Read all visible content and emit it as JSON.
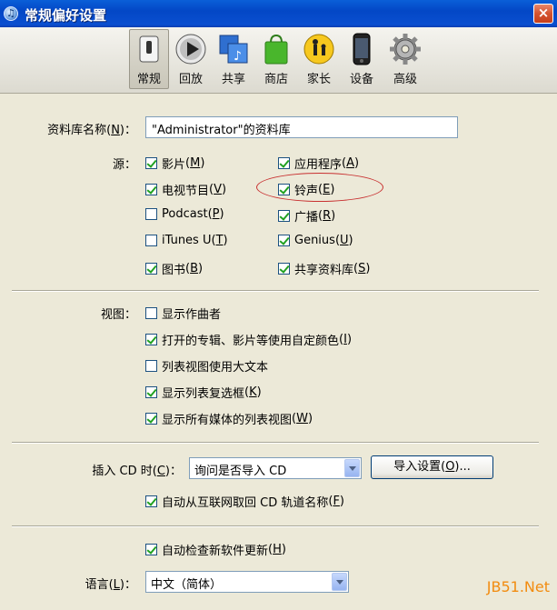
{
  "window": {
    "title": "常规偏好设置",
    "close": "×"
  },
  "toolbar": [
    {
      "label": "常规",
      "icon": "general-switch-icon"
    },
    {
      "label": "回放",
      "icon": "playback-icon"
    },
    {
      "label": "共享",
      "icon": "sharing-icon"
    },
    {
      "label": "商店",
      "icon": "store-bag-icon"
    },
    {
      "label": "家长",
      "icon": "parental-icon"
    },
    {
      "label": "设备",
      "icon": "device-icon"
    },
    {
      "label": "高级",
      "icon": "advanced-gear-icon"
    }
  ],
  "library": {
    "label": "资料库名称",
    "key": "N",
    "value": "\"Administrator\"的资料库"
  },
  "sources": {
    "label": "源：",
    "items": [
      {
        "text": "影片",
        "key": "M",
        "checked": true
      },
      {
        "text": "应用程序",
        "key": "A",
        "checked": true
      },
      {
        "text": "电视节目",
        "key": "V",
        "checked": true
      },
      {
        "text": "铃声",
        "key": "E",
        "checked": true
      },
      {
        "text": "Podcast",
        "key": "P",
        "checked": false
      },
      {
        "text": "广播",
        "key": "R",
        "checked": true
      },
      {
        "text": "iTunes U",
        "key": "T",
        "checked": false
      },
      {
        "text": "Genius",
        "key": "U",
        "checked": true
      },
      {
        "text": "图书",
        "key": "B",
        "checked": true
      },
      {
        "text": "共享资料库",
        "key": "S",
        "checked": true
      }
    ]
  },
  "views": {
    "label": "视图：",
    "items": [
      {
        "text": "显示作曲者",
        "key": "",
        "checked": false
      },
      {
        "text": "打开的专辑、影片等使用自定颜色",
        "key": "I",
        "checked": true
      },
      {
        "text": "列表视图使用大文本",
        "key": "",
        "checked": false
      },
      {
        "text": "显示列表复选框",
        "key": "K",
        "checked": true
      },
      {
        "text": "显示所有媒体的列表视图",
        "key": "W",
        "checked": true
      }
    ]
  },
  "cd": {
    "label": "插入 CD 时",
    "key": "C",
    "value": "询问是否导入 CD",
    "import_button": "导入设置",
    "import_key": "O",
    "auto_names": {
      "text": "自动从互联网取回 CD 轨道名称",
      "key": "F",
      "checked": true
    }
  },
  "updates": {
    "text": "自动检查新软件更新",
    "key": "H",
    "checked": true
  },
  "language": {
    "label": "语言",
    "key": "L",
    "value": "中文（简体）"
  },
  "watermark": "JB51.Net",
  "colors": {
    "titlebar": "#0347c6",
    "dialog": "#ece9d8",
    "check": "#21a121",
    "highlight": "#c83030"
  }
}
